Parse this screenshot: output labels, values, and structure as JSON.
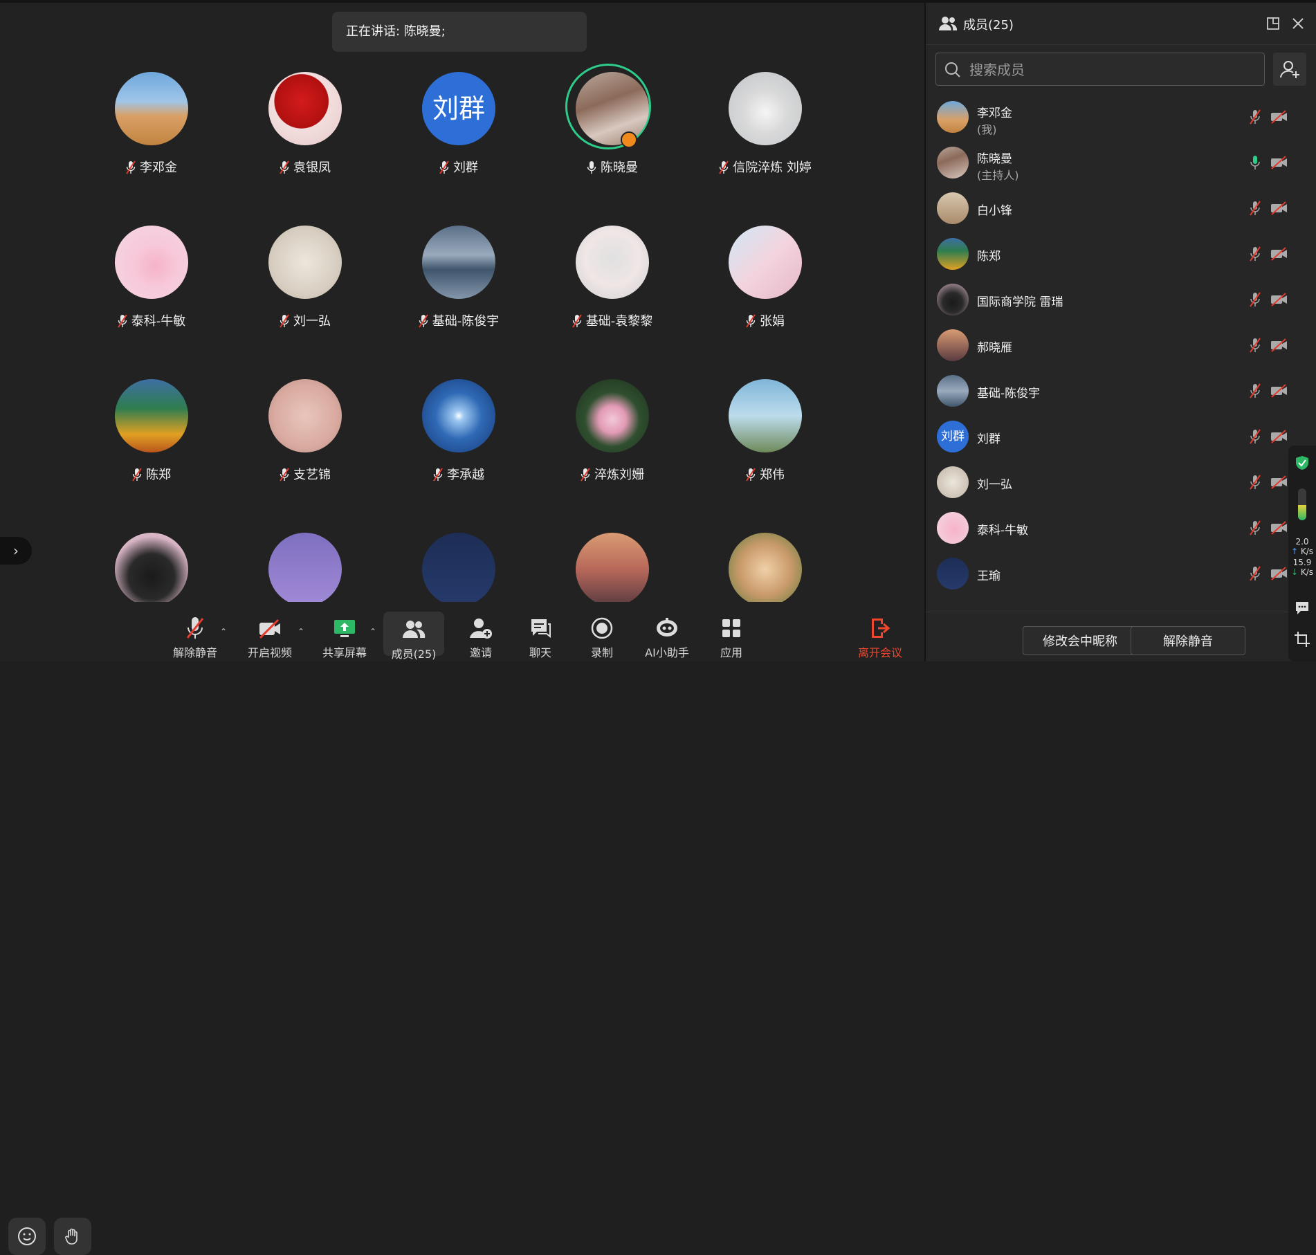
{
  "speaking": {
    "text": "正在讲话: 陈晓曼;"
  },
  "grid": [
    {
      "name": "李邓金",
      "bg": "linear-gradient(180deg,#6fa8dc 0%,#9fc5e8 40%,#d9a066 60%,#c18340 100%)"
    },
    {
      "name": "袁银凤",
      "bg": "radial-gradient(circle at 45% 40%,#d41b1b 0%,#b01010 45%,#f2dede 46%,#e8c8c8 100%)"
    },
    {
      "name": "刘群",
      "text": "刘群"
    },
    {
      "name": "陈晓曼",
      "bg": "linear-gradient(160deg,#b9a89c 0%,#8c6a5a 40%,#d8c8c0 70%,#9a7b6a 100%)",
      "speaking": true
    },
    {
      "name": "信院淬炼 刘婷",
      "bg": "radial-gradient(circle at 50% 55%,#f5f5f5 0%,#d9d9d9 40%,#bfc4c9 100%)"
    },
    {
      "name": "泰科-牛敏",
      "bg": "radial-gradient(circle at 55% 55%,#f6b3c8 0%,#f7c9da 40%,#f4d7e4 100%)"
    },
    {
      "name": "刘一弘",
      "bg": "radial-gradient(circle at 50% 50%,#ece6dc 0%,#d8cfc2 60%,#bfb3a3 100%)"
    },
    {
      "name": "基础-陈俊宇",
      "bg": "linear-gradient(180deg,#5a6f86 0%,#9aaabd 40%,#3f556b 60%,#8396ab 100%)"
    },
    {
      "name": "基础-袁黎黎",
      "bg": "radial-gradient(circle at 50% 45%,#e0e0e0 0%,#f0e6e6 50%,#cfcfcf 100%)"
    },
    {
      "name": "张娟",
      "bg": "linear-gradient(135deg,#cfe8f5 0%,#f3d4de 50%,#e6b7c8 100%)"
    },
    {
      "name": "陈郑",
      "bg": "linear-gradient(180deg,#3e6fa3 0%,#2f7d4f 40%,#e0a023 75%,#b8561b 100%)"
    },
    {
      "name": "支艺锦",
      "bg": "radial-gradient(circle at 50% 50%,#e8c6bc 0%,#d9aaa0 60%,#b88a82 100%)"
    },
    {
      "name": "李承越",
      "bg": "radial-gradient(circle at 50% 50%,#ffffff 0%,#9cc7f0 10%,#2f69b5 45%,#163a78 100%)"
    },
    {
      "name": "淬炼刘姗",
      "bg": "radial-gradient(circle at 50% 55%,#f3c9d8 0%,#e29ab5 25%,#2f4f2f 50%,#1c2f1c 100%)"
    },
    {
      "name": "郑伟",
      "bg": "linear-gradient(180deg,#7fb5d8 0%,#bcdcec 50%,#6e8a5a 100%)"
    },
    {
      "name": "",
      "bg": "radial-gradient(circle at 50% 60%,#1a1a1a 0%,#2a2a2a 40%,#d7b3c4 70%,#e8cfd9 100%)"
    },
    {
      "name": "",
      "bg": "linear-gradient(180deg,#7f6fc0 0%,#a08ad6 100%)"
    },
    {
      "name": "",
      "bg": "linear-gradient(180deg,#1d2d55 0%,#263a6b 100%)"
    },
    {
      "name": "",
      "bg": "linear-gradient(180deg,#d99b73 0%,#b8685a 50%,#5a3b40 100%)"
    },
    {
      "name": "",
      "bg": "radial-gradient(circle at 50% 50%,#f0d0a8 0%,#c99a6a 50%,#5a7a3a 100%)"
    }
  ],
  "toolbar": {
    "unmute": "解除静音",
    "video": "开启视频",
    "share": "共享屏幕",
    "members": "成员(25)",
    "invite": "邀请",
    "chat": "聊天",
    "record": "录制",
    "ai": "AI小助手",
    "apps": "应用",
    "leave": "离开会议"
  },
  "panel": {
    "title": "成员(25)",
    "search_placeholder": "搜索成员",
    "members": [
      {
        "name": "李邓金",
        "role": "(我)",
        "bg": "linear-gradient(180deg,#6fa8dc 0%,#d9a066 60%,#c18340 100%)",
        "mic": "off"
      },
      {
        "name": "陈晓曼",
        "role": "(主持人)",
        "bg": "linear-gradient(160deg,#b9a89c 0%,#8c6a5a 40%,#d8c8c0 100%)",
        "mic": "on"
      },
      {
        "name": "白小锋",
        "role": "",
        "bg": "linear-gradient(180deg,#d8c8b0 0%,#a88a6a 100%)",
        "mic": "off"
      },
      {
        "name": "陈郑",
        "role": "",
        "bg": "linear-gradient(180deg,#3e6fa3 0%,#2f7d4f 40%,#e0a023 100%)",
        "mic": "off"
      },
      {
        "name": "国际商学院 雷瑞",
        "role": "",
        "bg": "radial-gradient(circle at 50% 60%,#1a1a1a 0%,#2a2a2a 40%,#d7b3c4 100%)",
        "mic": "off"
      },
      {
        "name": "郝晓雁",
        "role": "",
        "bg": "linear-gradient(180deg,#d99b73 0%,#5a3b40 100%)",
        "mic": "off"
      },
      {
        "name": "基础-陈俊宇",
        "role": "",
        "bg": "linear-gradient(180deg,#5a6f86 0%,#9aaabd 50%,#3f556b 100%)",
        "mic": "off"
      },
      {
        "name": "刘群",
        "role": "",
        "text": "刘群",
        "mic": "off"
      },
      {
        "name": "刘一弘",
        "role": "",
        "bg": "radial-gradient(circle at 50% 50%,#ece6dc 0%,#bfb3a3 100%)",
        "mic": "off"
      },
      {
        "name": "泰科-牛敏",
        "role": "",
        "bg": "radial-gradient(circle at 55% 55%,#f6b3c8 0%,#f4d7e4 100%)",
        "mic": "off"
      },
      {
        "name": "王瑜",
        "role": "",
        "bg": "linear-gradient(180deg,#1d2d55 0%,#263a6b 100%)",
        "mic": "off"
      }
    ],
    "rename_button": "修改会中昵称",
    "unmute_all_button": "解除静音"
  },
  "network": {
    "up": "2.0",
    "up_unit": "K/s",
    "down": "15.9",
    "down_unit": "K/s"
  },
  "colors": {
    "accent_green": "#2ecc8a",
    "leave_red": "#f0462d",
    "avatar_blue": "#2d6fd6"
  }
}
